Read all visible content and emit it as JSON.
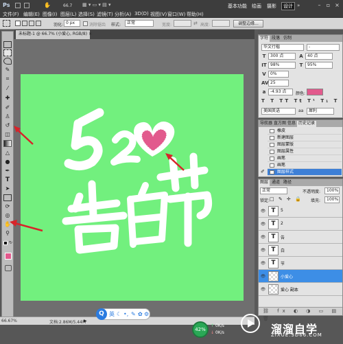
{
  "app": {
    "logo": "Ps",
    "zoom_menu": "66.7",
    "menu": [
      "文件(F)",
      "编辑(E)",
      "图像(I)",
      "图层(L)",
      "选择(S)",
      "滤镜(T)",
      "分析(A)",
      "3D(D)",
      "视图(V)",
      "窗口(W)",
      "帮助(H)"
    ],
    "workspace_buttons": [
      "基本功能",
      "绘画",
      "摄影"
    ],
    "design_button": "设计"
  },
  "options_bar": {
    "feather_label": "羽化:",
    "feather_value": "0 px",
    "antialias_label": "消除锯齿",
    "style_label": "样式:",
    "style_value": "正常",
    "width_label": "宽度:",
    "height_label": "高度:",
    "refine_button": "调整边缘..."
  },
  "document": {
    "tab_title": "未标题-1 @ 66.7% (小爱心, RGB/8) ×",
    "zoom": "66.67%",
    "doc_info": "文档:2.86M/5.44M"
  },
  "canvas": {
    "background_color": "#72f07e",
    "text_520": "520",
    "title_text": "告白节",
    "heart_color": "#e25a8d"
  },
  "character_panel": {
    "tabs": [
      "字符",
      "段落",
      "仿制"
    ],
    "font_family": "华文行楷",
    "font_style": "-",
    "font_size": "300 点",
    "leading": "40 点",
    "vertical_scale": "98%",
    "horizontal_scale": "95%",
    "baseline_percent": "0%",
    "tracking": "25",
    "baseline_shift": "-4.93 点",
    "color_label": "颜色:",
    "color": "#e25a8d",
    "language": "美国英语",
    "antialias_mode": "犀利"
  },
  "history_panel": {
    "tabs": [
      "导航器",
      "直方图",
      "信息",
      "历史记录"
    ],
    "items": [
      "橡皮",
      "新建图层",
      "图层蒙版",
      "图层属性",
      "画笔",
      "画笔",
      "图层样式"
    ],
    "active_index": 6
  },
  "layers_panel": {
    "tabs": [
      "图层",
      "通道",
      "路径"
    ],
    "blend_mode": "正常",
    "opacity_label": "不透明度:",
    "opacity": "100%",
    "lock_label": "锁定:",
    "fill_label": "填充:",
    "fill": "100%",
    "layers": [
      {
        "name": "5",
        "thumb": "T"
      },
      {
        "name": "2",
        "thumb": "T"
      },
      {
        "name": "告",
        "thumb": "T"
      },
      {
        "name": "白",
        "thumb": "T"
      },
      {
        "name": "节",
        "thumb": "T"
      },
      {
        "name": "小爱心",
        "thumb": ""
      },
      {
        "name": "爱心 副本",
        "thumb": ""
      }
    ],
    "active_index": 5
  },
  "overlay": {
    "ime_label": "英",
    "net_percent": "42%",
    "net_up": "0K/s",
    "net_down": "0K/s"
  },
  "watermark": {
    "title": "溜溜自学",
    "url": "ZIXUE.3D66.COM"
  }
}
